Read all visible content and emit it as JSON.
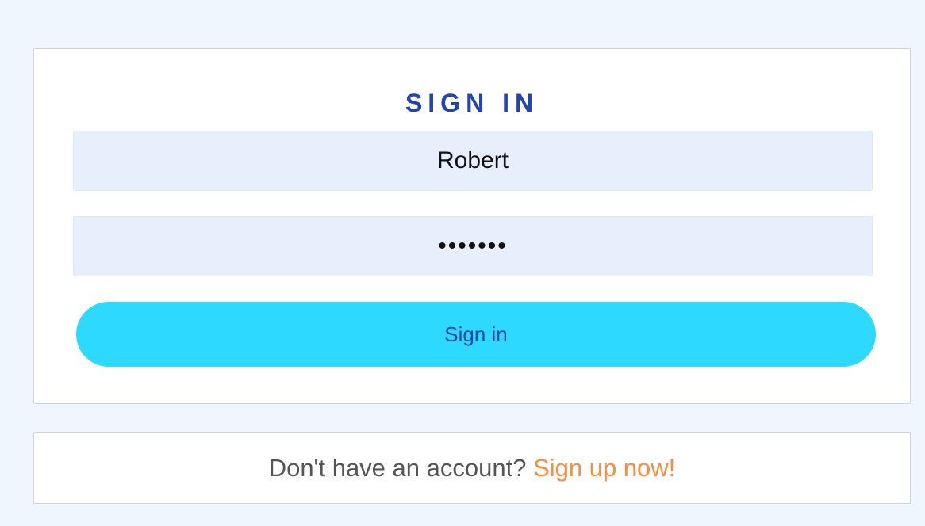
{
  "signin": {
    "title": "SIGN IN",
    "username_value": "Robert",
    "password_value": "robert1",
    "button_label": "Sign in"
  },
  "signup": {
    "prompt": "Don't have an account?",
    "link_label": "Sign up now!"
  },
  "colors": {
    "background": "#eff6fe",
    "title": "#2244b0",
    "field_bg": "#e7effc",
    "button_bg": "#2ed9ff",
    "button_text": "#2244b0",
    "link": "#fa8c40"
  }
}
